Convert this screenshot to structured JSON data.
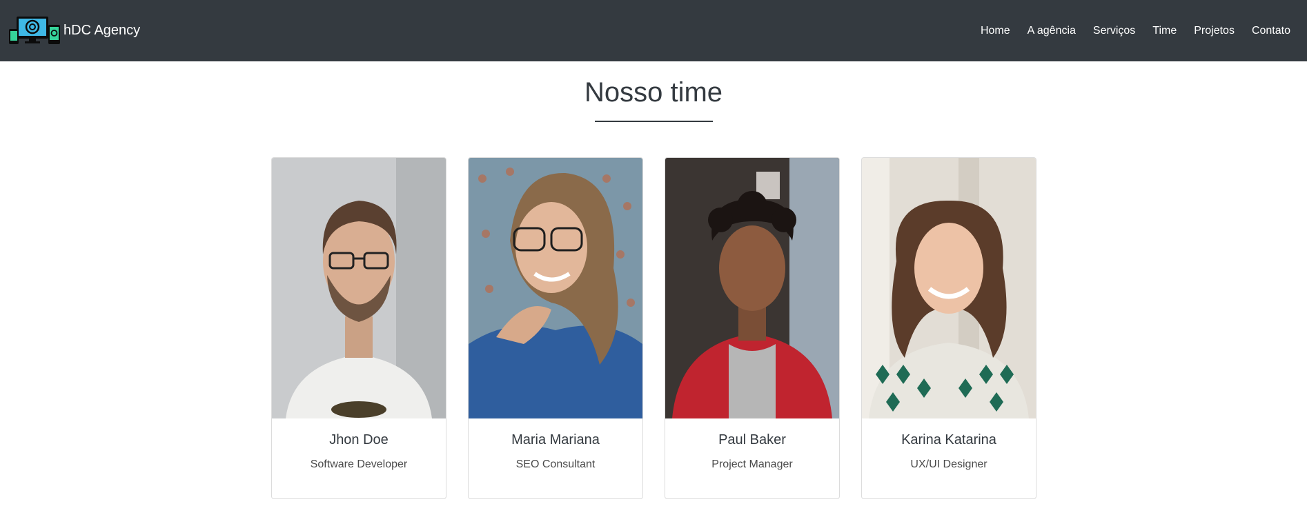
{
  "brand": {
    "name": "hDC Agency",
    "logo": "devices-logo-icon"
  },
  "nav": {
    "items": [
      {
        "label": "Home"
      },
      {
        "label": "A agência"
      },
      {
        "label": "Serviços"
      },
      {
        "label": "Time"
      },
      {
        "label": "Projetos"
      },
      {
        "label": "Contato"
      }
    ]
  },
  "team": {
    "title": "Nosso time",
    "members": [
      {
        "name": "Jhon Doe",
        "role": "Software Developer",
        "photo": "portrait-man-glasses"
      },
      {
        "name": "Maria Mariana",
        "role": "SEO Consultant",
        "photo": "portrait-woman-glasses"
      },
      {
        "name": "Paul Baker",
        "role": "Project Manager",
        "photo": "portrait-man-red-jacket"
      },
      {
        "name": "Karina Katarina",
        "role": "UX/UI Designer",
        "photo": "portrait-woman-curly-hair"
      }
    ]
  },
  "colors": {
    "navbar": "#343a40",
    "text": "#343a40",
    "card_border": "#dcdcdc"
  }
}
